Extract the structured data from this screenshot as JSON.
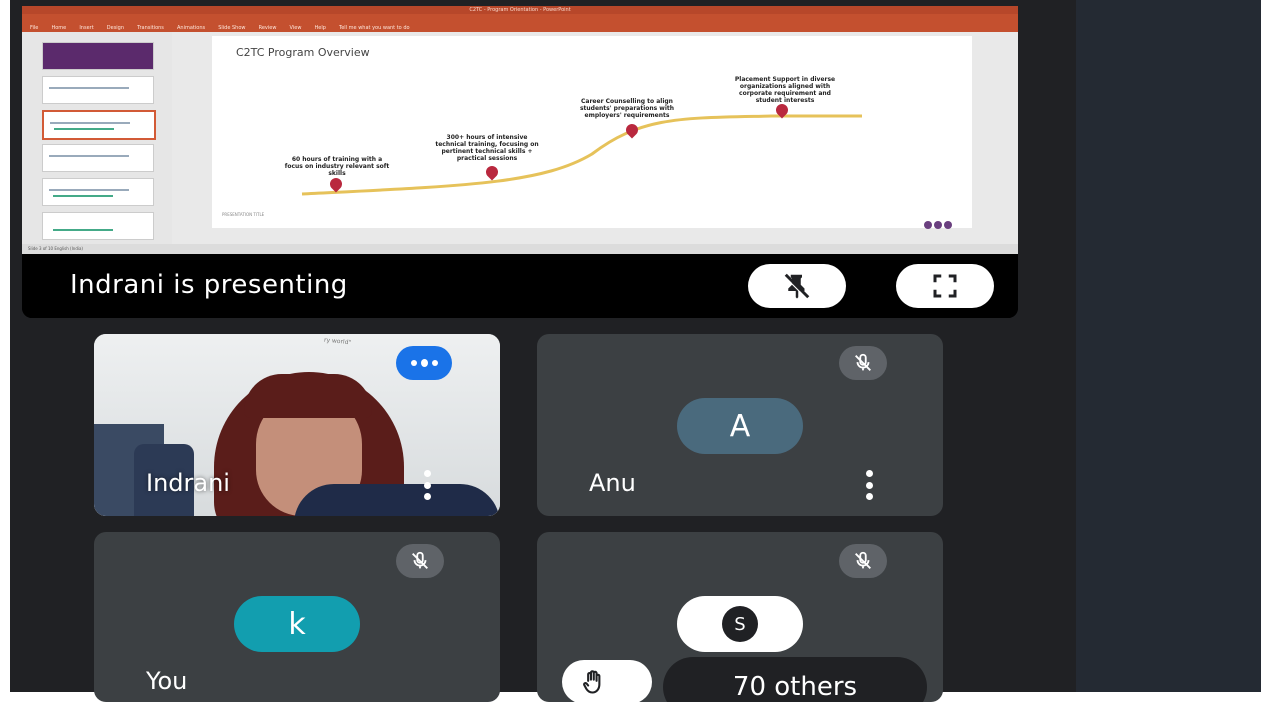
{
  "presentation": {
    "window_title": "C2TC - Program Orientation - PowerPoint",
    "ribbon_tabs": [
      "File",
      "Home",
      "Insert",
      "Design",
      "Transitions",
      "Animations",
      "Slide Show",
      "Review",
      "View",
      "Help",
      "Tell me what you want to do"
    ],
    "slide_title": "C2TC Program Overview",
    "milestones": [
      "60 hours of training with a focus on industry relevant soft skills",
      "300+ hours of intensive technical training, focusing on pertinent technical skills + practical sessions",
      "Career Counselling to align students' preparations with employers' requirements",
      "Placement Support in diverse organizations aligned with corporate requirement and student interests"
    ],
    "slide_footer": "PRESENTATION TITLE",
    "status_bar": "Slide 3 of 10   English (India)",
    "presenting_label": "Indrani is presenting"
  },
  "participants": [
    {
      "name": "Indrani",
      "type": "video",
      "speaking": true
    },
    {
      "name": "Anu",
      "initial": "A",
      "avatar_color": "#4a6a7d",
      "muted": true
    },
    {
      "name": "You",
      "initial": "k",
      "avatar_color": "#129eaf",
      "muted": true
    },
    {
      "name": "70 others",
      "initial": "S",
      "muted": true
    }
  ],
  "colors": {
    "meet_bg": "#202124",
    "tile_bg": "#3c4043",
    "accent_blue": "#1a73e8",
    "ppt_orange": "#c4502f"
  },
  "icons": {
    "unpin": "unpin-icon",
    "fullscreen": "fullscreen-icon",
    "mic_off": "mic-off-icon",
    "more": "more-vert-icon",
    "hand": "raise-hand-icon",
    "speaking": "speaking-indicator-icon"
  }
}
